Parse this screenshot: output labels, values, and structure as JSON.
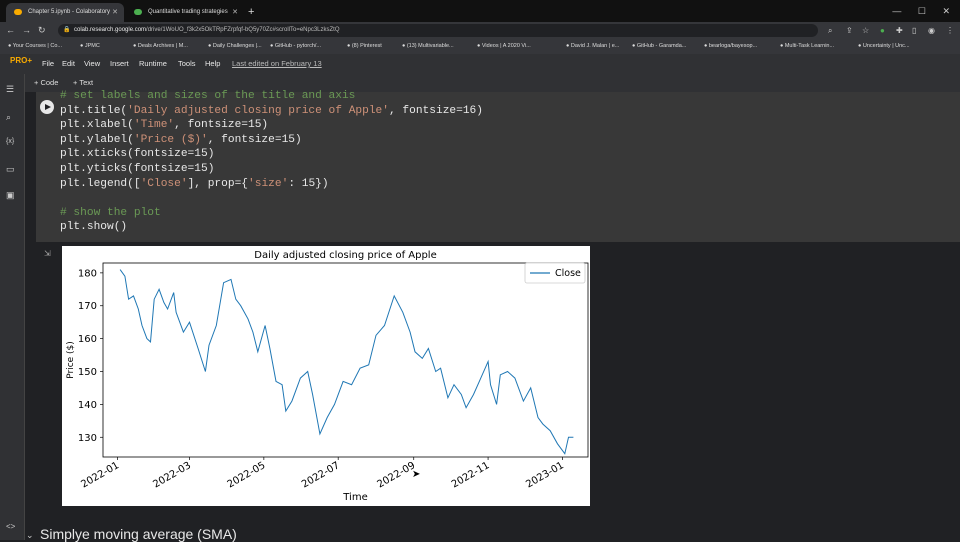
{
  "browser": {
    "tabs": [
      {
        "title": "Chapter 5.ipynb - Colaboratory",
        "fav_color": "#f9ab00"
      },
      {
        "title": "Quantitative trading strategies",
        "fav_color": "#4caf50"
      }
    ],
    "url_domain": "colab.research.google.com",
    "url_path": "/drive/1WoUO_f3k2x5OkTRpFZrpfqf-bQ5y70Zc#scrollTo=eNpc3LzksZtQ",
    "bookmarks": [
      "Your Courses | Co...",
      "JPMC",
      "Deals Archives | M...",
      "Daily Challenges |...",
      "GitHub - pytorch/...",
      "(8) Pinterest",
      "(13) Multivariable...",
      "Videos | A 2020 Vi...",
      "David J. Malan | e...",
      "GitHub - Garamda...",
      "bearloga/bayesop...",
      "Multi-Task Learnin...",
      "Uncertainty | Unc..."
    ]
  },
  "colab": {
    "logo": "PRO+",
    "menu": [
      "File",
      "Edit",
      "View",
      "Insert",
      "Runtime",
      "Tools",
      "Help"
    ],
    "last_edited": "Last edited on February 13",
    "add_code": "+ Code",
    "add_text": "+ Text"
  },
  "code_cell": {
    "lines": [
      [
        {
          "t": "# set labels and sizes of the title and axis",
          "c": "c"
        }
      ],
      [
        {
          "t": "plt.title("
        },
        {
          "t": "'Daily adjusted closing price of Apple'",
          "c": "s"
        },
        {
          "t": ", fontsize=16)"
        }
      ],
      [
        {
          "t": "plt.xlabel("
        },
        {
          "t": "'Time'",
          "c": "s"
        },
        {
          "t": ", fontsize=15)"
        }
      ],
      [
        {
          "t": "plt.ylabel("
        },
        {
          "t": "'Price ($)'",
          "c": "s"
        },
        {
          "t": ", fontsize=15)"
        }
      ],
      [
        {
          "t": "plt.xticks(fontsize=15)"
        }
      ],
      [
        {
          "t": "plt.yticks(fontsize=15)"
        }
      ],
      [
        {
          "t": "plt.legend(["
        },
        {
          "t": "'Close'",
          "c": "s"
        },
        {
          "t": "], prop={"
        },
        {
          "t": "'size'",
          "c": "s"
        },
        {
          "t": ": 15})"
        }
      ],
      [
        {
          "t": ""
        }
      ],
      [
        {
          "t": "# show the plot",
          "c": "c"
        }
      ],
      [
        {
          "t": "plt.show()"
        }
      ]
    ]
  },
  "next_section": "Simplye moving average (SMA)",
  "chart_data": {
    "type": "line",
    "title": "Daily adjusted closing price of Apple",
    "xlabel": "Time",
    "ylabel": "Price ($)",
    "xticks": [
      "2022-01",
      "2022-03",
      "2022-05",
      "2022-07",
      "2022-09",
      "2022-11",
      "2023-01"
    ],
    "yticks": [
      130,
      140,
      150,
      160,
      170,
      180
    ],
    "ylim": [
      124,
      183
    ],
    "legend": "top-right",
    "series": [
      {
        "name": "Close",
        "color": "#1f77b4",
        "x": [
          "2022-01-03",
          "2022-01-07",
          "2022-01-10",
          "2022-01-14",
          "2022-01-18",
          "2022-01-21",
          "2022-01-25",
          "2022-01-28",
          "2022-01-31",
          "2022-02-04",
          "2022-02-08",
          "2022-02-11",
          "2022-02-16",
          "2022-02-18",
          "2022-02-24",
          "2022-03-01",
          "2022-03-08",
          "2022-03-14",
          "2022-03-17",
          "2022-03-23",
          "2022-03-29",
          "2022-04-04",
          "2022-04-08",
          "2022-04-12",
          "2022-04-18",
          "2022-04-22",
          "2022-04-26",
          "2022-05-02",
          "2022-05-06",
          "2022-05-11",
          "2022-05-16",
          "2022-05-19",
          "2022-05-24",
          "2022-05-31",
          "2022-06-06",
          "2022-06-10",
          "2022-06-16",
          "2022-06-22",
          "2022-06-28",
          "2022-07-05",
          "2022-07-12",
          "2022-07-19",
          "2022-07-26",
          "2022-08-01",
          "2022-08-08",
          "2022-08-16",
          "2022-08-23",
          "2022-08-29",
          "2022-09-02",
          "2022-09-08",
          "2022-09-13",
          "2022-09-19",
          "2022-09-23",
          "2022-09-29",
          "2022-10-04",
          "2022-10-10",
          "2022-10-14",
          "2022-10-20",
          "2022-10-26",
          "2022-11-01",
          "2022-11-03",
          "2022-11-08",
          "2022-11-11",
          "2022-11-17",
          "2022-11-23",
          "2022-11-30",
          "2022-12-06",
          "2022-12-12",
          "2022-12-16",
          "2022-12-22",
          "2022-12-28",
          "2023-01-03",
          "2023-01-06",
          "2023-01-10"
        ],
        "y": [
          181,
          179,
          172,
          173,
          169,
          164,
          160,
          159,
          172,
          175,
          171,
          169,
          174,
          168,
          162,
          165,
          157,
          150,
          158,
          164,
          177,
          178,
          172,
          170,
          166,
          162,
          156,
          164,
          157,
          147,
          146,
          138,
          141,
          148,
          150,
          143,
          131,
          136,
          140,
          147,
          146,
          151,
          152,
          161,
          164,
          173,
          168,
          162,
          156,
          154,
          157,
          150,
          151,
          142,
          146,
          143,
          139,
          143,
          148,
          153,
          146,
          140,
          149,
          150,
          148,
          141,
          145,
          136,
          134,
          132,
          128,
          125,
          130,
          130
        ]
      }
    ]
  }
}
